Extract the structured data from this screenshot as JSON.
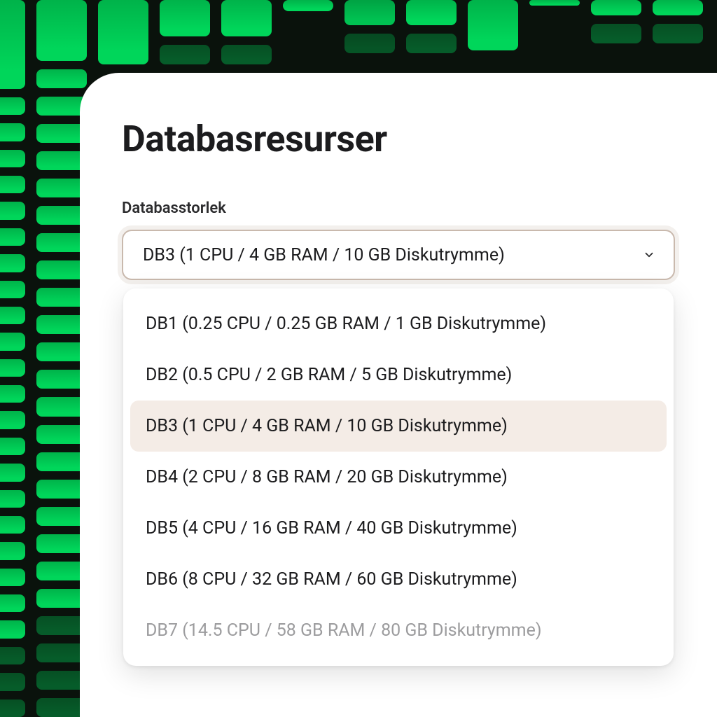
{
  "panel": {
    "title": "Databasresurser",
    "field_label": "Databasstorlek"
  },
  "select": {
    "value": "DB3 (1 CPU / 4 GB RAM / 10 GB Diskutrymme)",
    "options": [
      {
        "label": "DB1 (0.25 CPU / 0.25 GB RAM / 1 GB Diskutrymme)",
        "selected": false,
        "disabled": false
      },
      {
        "label": "DB2 (0.5 CPU / 2 GB RAM / 5 GB Diskutrymme)",
        "selected": false,
        "disabled": false
      },
      {
        "label": "DB3 (1 CPU / 4 GB RAM / 10 GB Diskutrymme)",
        "selected": true,
        "disabled": false
      },
      {
        "label": "DB4 (2 CPU / 8 GB RAM / 20 GB Diskutrymme)",
        "selected": false,
        "disabled": false
      },
      {
        "label": "DB5 (4 CPU / 16 GB RAM / 40 GB Diskutrymme)",
        "selected": false,
        "disabled": false
      },
      {
        "label": "DB6 (8 CPU / 32 GB RAM / 60 GB Diskutrymme)",
        "selected": false,
        "disabled": false
      },
      {
        "label": "DB7 (14.5 CPU / 58 GB RAM / 80 GB Diskutrymme)",
        "selected": false,
        "disabled": true
      }
    ]
  },
  "colors": {
    "accent_green": "#00d65a",
    "select_border": "#c9b9ad",
    "highlight_bg": "#f4ece6"
  }
}
